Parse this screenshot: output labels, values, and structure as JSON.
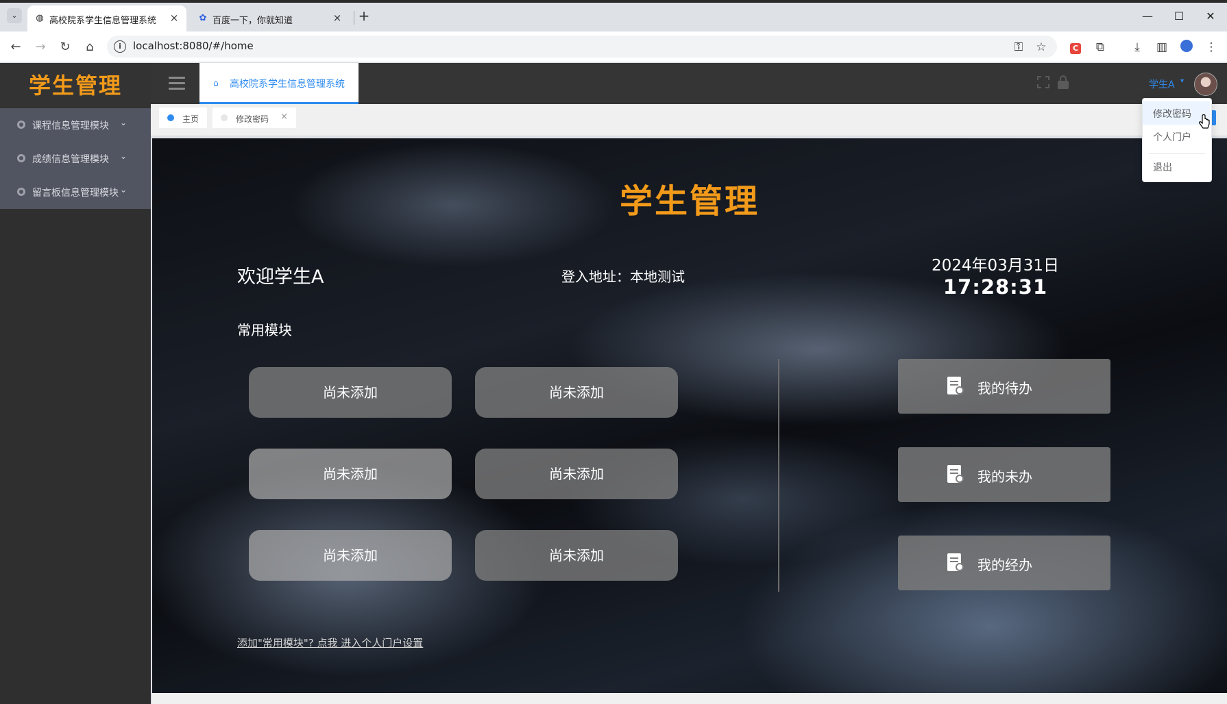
{
  "browser": {
    "tabs": [
      {
        "title": "高校院系学生信息管理系统",
        "active": true,
        "icon": "globe-icon"
      },
      {
        "title": "百度一下，你就知道",
        "active": false,
        "icon": "baidu-paw-icon"
      }
    ],
    "new_tab_symbol": "+",
    "url": "localhost:8080/#/home",
    "window_controls": {
      "minimize": "—",
      "maximize": "☐",
      "close": "✕"
    }
  },
  "sidebar": {
    "logo": "学生管理",
    "items": [
      {
        "label": "课程信息管理模块"
      },
      {
        "label": "成绩信息管理模块"
      },
      {
        "label": "留言板信息管理模块"
      }
    ]
  },
  "header": {
    "active_tab": "高校院系学生信息管理系统",
    "user_name": "学生A"
  },
  "tags": [
    {
      "label": "主页",
      "active": true
    },
    {
      "label": "修改密码",
      "active": false,
      "closable": true
    }
  ],
  "main": {
    "logo": "学生管理",
    "welcome": "欢迎学生A",
    "login_address": "登入地址：本地测试",
    "date": "2024年03月31日",
    "time": "17:28:31",
    "common_modules_title": "常用模块",
    "quick_buttons": [
      "尚未添加",
      "尚未添加",
      "尚未添加",
      "尚未添加",
      "尚未添加",
      "尚未添加"
    ],
    "side_buttons": [
      {
        "label": "我的待办",
        "icon": "todo-doc-icon"
      },
      {
        "label": "我的未办",
        "icon": "pending-doc-icon"
      },
      {
        "label": "我的经办",
        "icon": "handled-doc-icon"
      }
    ],
    "portal_link": "添加\"常用模块\"? 点我 进入个人门户设置"
  },
  "user_dropdown": {
    "items": [
      "修改密码",
      "个人门户",
      "退出"
    ]
  },
  "colors": {
    "brand_orange": "#f29a1a",
    "accent_blue": "#2e8bf0",
    "sidebar_bg": "#2f2f2f",
    "menu_bg": "#515461"
  }
}
